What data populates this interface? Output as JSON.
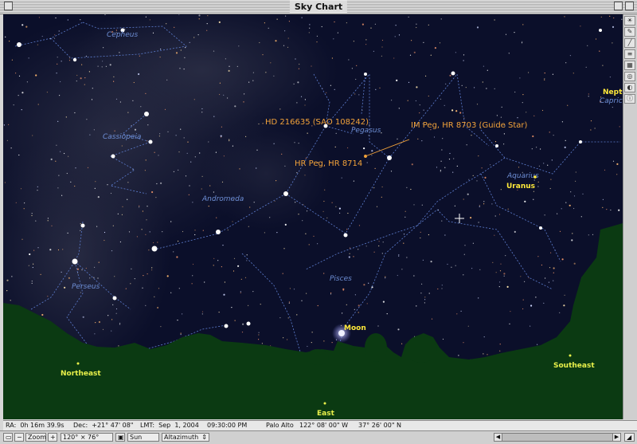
{
  "window": {
    "title": "Sky Chart"
  },
  "sky": {
    "constellations": [
      "Cepheus",
      "Cassiopeia",
      "Pegasus",
      "Andromeda",
      "Perseus",
      "Pisces",
      "Aquarius"
    ],
    "objects": {
      "hd": "HD 216635 (SAO 108242)",
      "im": "IM Peg, HR 8703 (Guide Star)",
      "hr": "HR Peg, HR 8714"
    },
    "planets": {
      "uranus": "Uranus",
      "neptune": "Neptu",
      "moon": "Moon",
      "capricornus": "Capricc"
    },
    "horizon": {
      "northeast": "Northeast",
      "east": "East",
      "southeast": "Southeast"
    }
  },
  "status": {
    "ra": "RA:  0h 16m 39.9s",
    "dec": "Dec:  +21° 47' 08\"",
    "lmt": "LMT:  Sep  1, 2004    09:30:00 PM",
    "location": "Palo Alto",
    "longitude": "122° 08' 00\" W",
    "latitude": "37° 26' 00\" N"
  },
  "controls": {
    "zoom_label": "Zoom",
    "fov": "120°  ×  76°",
    "center_object": "Sun",
    "projection": "Altazimuth"
  },
  "colors": {
    "sky": "#0b0f2a",
    "ground": "#0b3a12",
    "lines": "#5e7ed0",
    "object_labels": "#f2a23a",
    "planet_labels": "#ffe93a"
  }
}
